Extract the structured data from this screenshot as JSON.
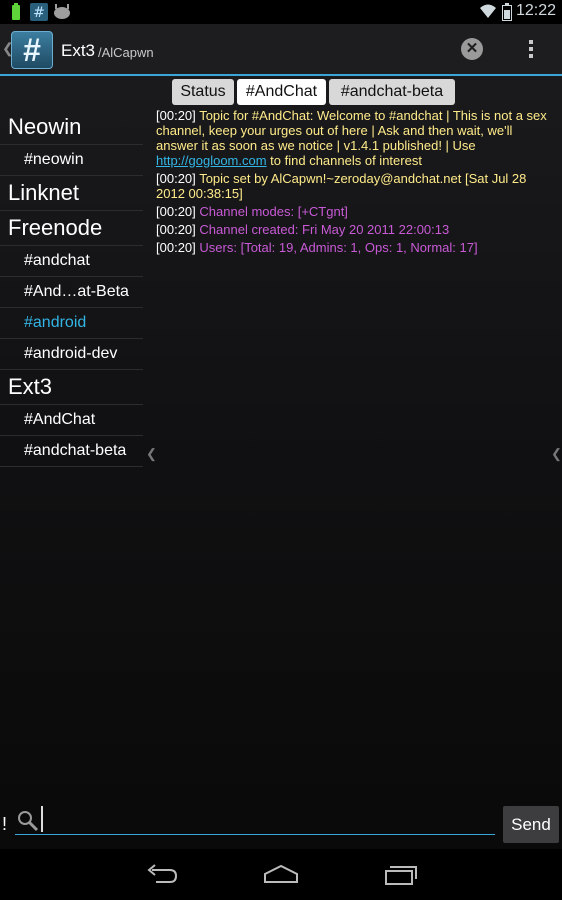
{
  "status_bar": {
    "time": "12:22"
  },
  "action_bar": {
    "app_icon_glyph": "#",
    "title": "Ext3",
    "subtitle": "/AlCapwn",
    "icons": [
      "close-channel-icon",
      "overflow-menu-icon"
    ]
  },
  "tabs": [
    {
      "label": "Status",
      "active": false
    },
    {
      "label": "#AndChat",
      "active": true
    },
    {
      "label": "#andchat-beta",
      "active": false
    }
  ],
  "sidebar": [
    {
      "server": "Neowin",
      "channels": [
        "#neowin"
      ]
    },
    {
      "server": "Linknet",
      "channels": []
    },
    {
      "server": "Freenode",
      "channels": [
        "#andchat",
        "#And…at-Beta",
        "#android",
        "#android-dev"
      ]
    },
    {
      "server": "Ext3",
      "channels": [
        "#AndChat",
        "#andchat-beta"
      ]
    }
  ],
  "selected_channel": "#android",
  "log": [
    {
      "time": "00:20",
      "text": "Topic for #AndChat: Welcome to #andchat | This is not a sex channel, keep your urges out of here | Ask and then wait, we'll answer it as soon as we notice | v1.4.1 published! | Use ",
      "link": "http://gogloom.com",
      "after": " to find channels of interest"
    },
    {
      "time": "00:20",
      "text": "Topic set by AlCapwn!~zeroday@andchat.net [Sat Jul 28 2012 00:38:15]"
    },
    {
      "time": "00:20",
      "text": "Channel modes: [+CTgnt]"
    },
    {
      "time": "00:20",
      "text": "Channel created: Fri May 20 2011 22:00:13"
    },
    {
      "time": "00:20",
      "text": "Users: [Total: 19,  Admins: 1,  Ops: 1,  Normal: 17]"
    }
  ],
  "input": {
    "prefix": "!",
    "value": "",
    "placeholder": ""
  },
  "send_label": "Send",
  "colors": {
    "accent": "#33b5e5",
    "topic": "#ffeb8a",
    "info": "#c85ad6"
  }
}
